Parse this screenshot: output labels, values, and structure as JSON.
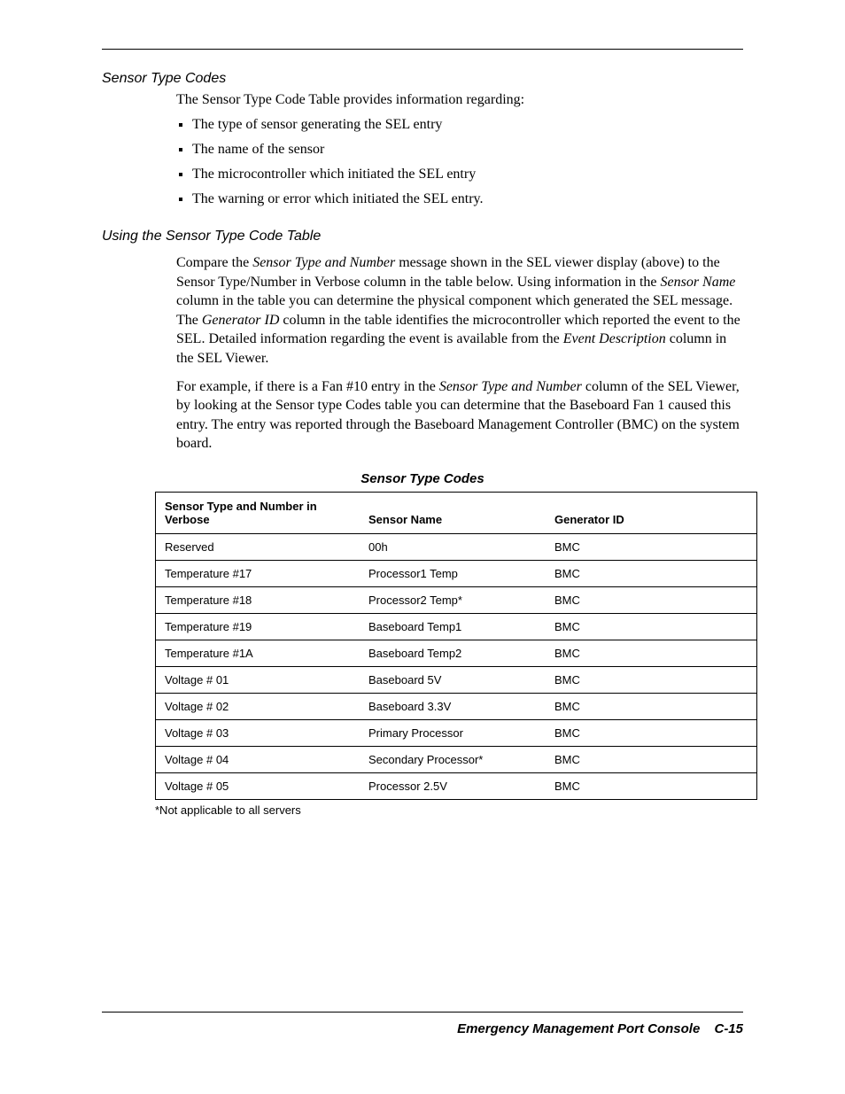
{
  "section1": {
    "heading": "Sensor Type Codes",
    "intro": "The Sensor Type Code Table provides information regarding:",
    "bullets": [
      "The type of sensor generating the SEL entry",
      "The name of the sensor",
      "The microcontroller which initiated the SEL entry",
      "The warning or error which initiated the SEL entry."
    ]
  },
  "section2": {
    "heading": "Using the Sensor Type Code Table",
    "para1_a": "Compare the ",
    "para1_i1": "Sensor Type and Number",
    "para1_b": " message shown in the SEL viewer display (above) to the Sensor Type/Number in Verbose column in the table below. Using information in the ",
    "para1_i2": "Sensor Name",
    "para1_c": " column in the table you can determine the physical component which generated the SEL message. The ",
    "para1_i3": "Generator ID",
    "para1_d": " column in the table identifies the microcontroller which reported the event to the SEL. Detailed information regarding the event is available from the ",
    "para1_i4": "Event Description",
    "para1_e": " column in the SEL Viewer.",
    "para2_a": "For example, if there is a Fan #10 entry in the ",
    "para2_i1": "Sensor Type and Number",
    "para2_b": " column of the SEL Viewer, by looking at the Sensor type Codes table you can determine that the Baseboard Fan 1 caused this entry. The entry was reported through the Baseboard Management Controller (BMC) on the system board."
  },
  "table": {
    "title": "Sensor Type Codes",
    "headers": {
      "col1": "Sensor Type and Number in Verbose",
      "col2": "Sensor Name",
      "col3": "Generator ID"
    },
    "rows": [
      {
        "c1": "Reserved",
        "c2": "00h",
        "c3": "BMC"
      },
      {
        "c1": "Temperature #17",
        "c2": "Processor1 Temp",
        "c3": "BMC"
      },
      {
        "c1": "Temperature #18",
        "c2": "Processor2 Temp*",
        "c3": "BMC"
      },
      {
        "c1": "Temperature #19",
        "c2": "Baseboard Temp1",
        "c3": "BMC"
      },
      {
        "c1": "Temperature #1A",
        "c2": "Baseboard Temp2",
        "c3": "BMC"
      },
      {
        "c1": "Voltage # 01",
        "c2": "Baseboard 5V",
        "c3": "BMC"
      },
      {
        "c1": "Voltage # 02",
        "c2": "Baseboard 3.3V",
        "c3": "BMC"
      },
      {
        "c1": "Voltage # 03",
        "c2": "Primary Processor",
        "c3": "BMC"
      },
      {
        "c1": "Voltage # 04",
        "c2": "Secondary Processor*",
        "c3": "BMC"
      },
      {
        "c1": "Voltage # 05",
        "c2": "Processor 2.5V",
        "c3": "BMC"
      }
    ],
    "note": "*Not applicable to all servers"
  },
  "footer": {
    "title": "Emergency Management Port Console",
    "pagenum": "C-15"
  }
}
